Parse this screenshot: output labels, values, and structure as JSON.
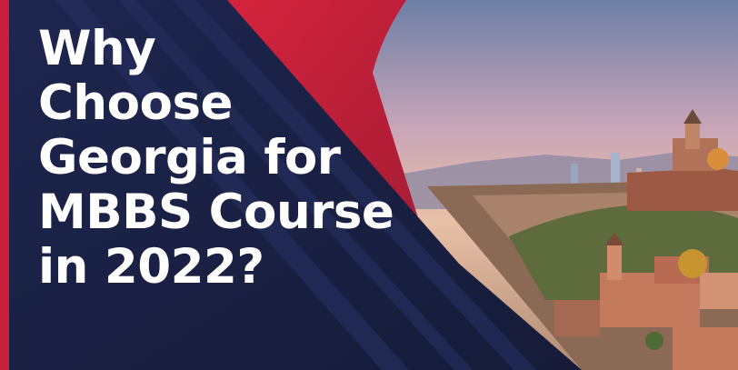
{
  "banner": {
    "headline_lines": [
      "Why",
      "Choose",
      "Georgia for",
      "MBBS Course",
      "in 2022?"
    ]
  },
  "colors": {
    "navy": "#1b2246",
    "navy_stripe": "#222b55",
    "red": "#c8203a",
    "text": "#ffffff"
  },
  "image": {
    "subject": "city skyline with church tower at sunset",
    "icon": "city-photo"
  }
}
